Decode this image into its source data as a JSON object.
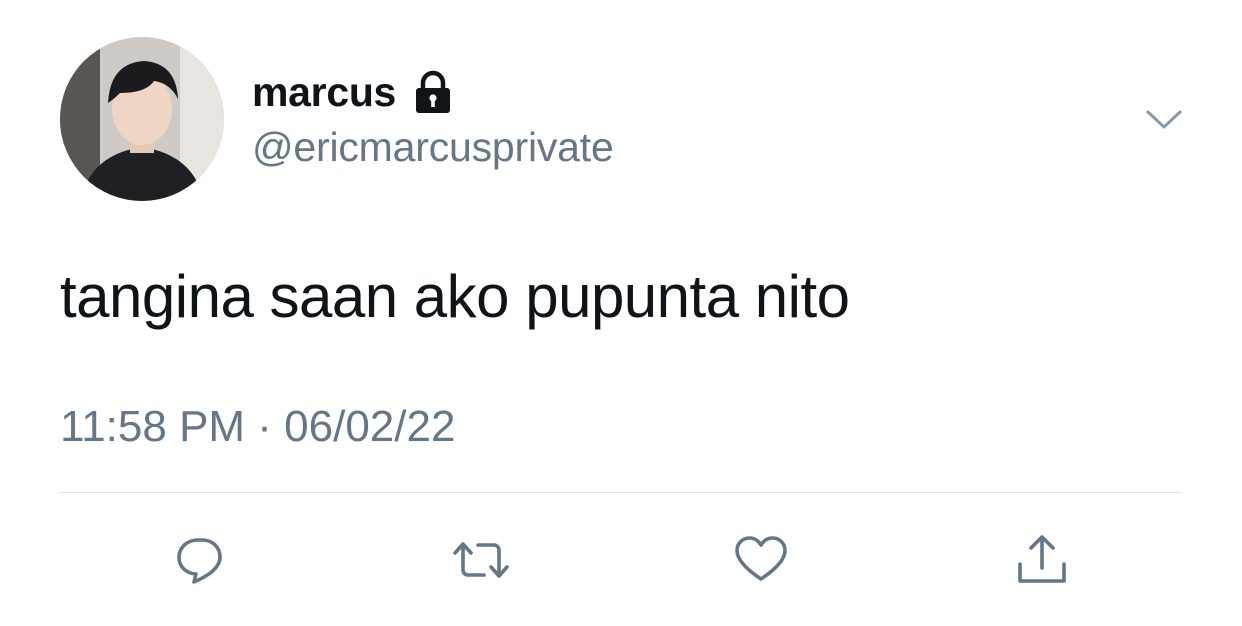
{
  "tweet": {
    "display_name": "marcus",
    "handle": "@ericmarcusprivate",
    "text": "tangina saan ako pupunta nito",
    "timestamp": "11:58 PM · 06/02/22",
    "protected_icon": "lock-icon"
  },
  "actions": [
    {
      "name": "reply",
      "icon": "speech-bubble-icon"
    },
    {
      "name": "retweet",
      "icon": "retweet-arrows-icon"
    },
    {
      "name": "like",
      "icon": "heart-icon"
    },
    {
      "name": "share",
      "icon": "share-upload-icon"
    }
  ],
  "colors": {
    "text_primary": "#0f1419",
    "text_secondary": "#657786",
    "divider": "#dfe3e6",
    "background": "#ffffff"
  }
}
